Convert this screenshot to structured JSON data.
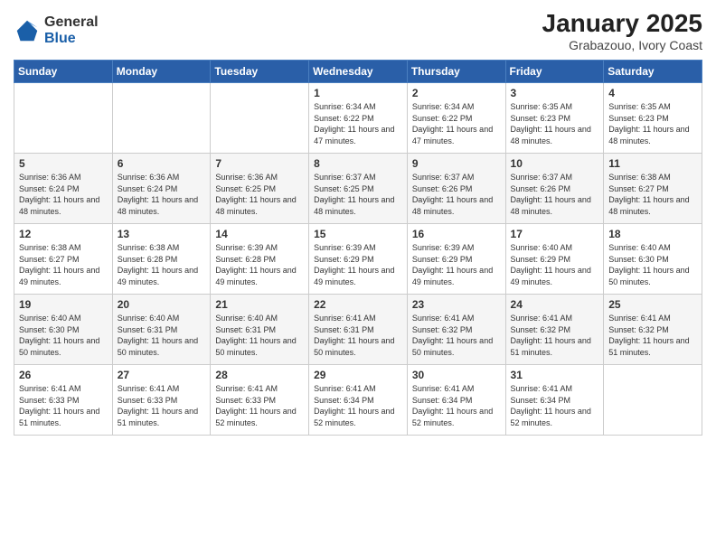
{
  "logo": {
    "general": "General",
    "blue": "Blue"
  },
  "header": {
    "month": "January 2025",
    "location": "Grabazouo, Ivory Coast"
  },
  "weekdays": [
    "Sunday",
    "Monday",
    "Tuesday",
    "Wednesday",
    "Thursday",
    "Friday",
    "Saturday"
  ],
  "weeks": [
    [
      {
        "day": "",
        "sunrise": "",
        "sunset": "",
        "daylight": ""
      },
      {
        "day": "",
        "sunrise": "",
        "sunset": "",
        "daylight": ""
      },
      {
        "day": "",
        "sunrise": "",
        "sunset": "",
        "daylight": ""
      },
      {
        "day": "1",
        "sunrise": "Sunrise: 6:34 AM",
        "sunset": "Sunset: 6:22 PM",
        "daylight": "Daylight: 11 hours and 47 minutes."
      },
      {
        "day": "2",
        "sunrise": "Sunrise: 6:34 AM",
        "sunset": "Sunset: 6:22 PM",
        "daylight": "Daylight: 11 hours and 47 minutes."
      },
      {
        "day": "3",
        "sunrise": "Sunrise: 6:35 AM",
        "sunset": "Sunset: 6:23 PM",
        "daylight": "Daylight: 11 hours and 48 minutes."
      },
      {
        "day": "4",
        "sunrise": "Sunrise: 6:35 AM",
        "sunset": "Sunset: 6:23 PM",
        "daylight": "Daylight: 11 hours and 48 minutes."
      }
    ],
    [
      {
        "day": "5",
        "sunrise": "Sunrise: 6:36 AM",
        "sunset": "Sunset: 6:24 PM",
        "daylight": "Daylight: 11 hours and 48 minutes."
      },
      {
        "day": "6",
        "sunrise": "Sunrise: 6:36 AM",
        "sunset": "Sunset: 6:24 PM",
        "daylight": "Daylight: 11 hours and 48 minutes."
      },
      {
        "day": "7",
        "sunrise": "Sunrise: 6:36 AM",
        "sunset": "Sunset: 6:25 PM",
        "daylight": "Daylight: 11 hours and 48 minutes."
      },
      {
        "day": "8",
        "sunrise": "Sunrise: 6:37 AM",
        "sunset": "Sunset: 6:25 PM",
        "daylight": "Daylight: 11 hours and 48 minutes."
      },
      {
        "day": "9",
        "sunrise": "Sunrise: 6:37 AM",
        "sunset": "Sunset: 6:26 PM",
        "daylight": "Daylight: 11 hours and 48 minutes."
      },
      {
        "day": "10",
        "sunrise": "Sunrise: 6:37 AM",
        "sunset": "Sunset: 6:26 PM",
        "daylight": "Daylight: 11 hours and 48 minutes."
      },
      {
        "day": "11",
        "sunrise": "Sunrise: 6:38 AM",
        "sunset": "Sunset: 6:27 PM",
        "daylight": "Daylight: 11 hours and 48 minutes."
      }
    ],
    [
      {
        "day": "12",
        "sunrise": "Sunrise: 6:38 AM",
        "sunset": "Sunset: 6:27 PM",
        "daylight": "Daylight: 11 hours and 49 minutes."
      },
      {
        "day": "13",
        "sunrise": "Sunrise: 6:38 AM",
        "sunset": "Sunset: 6:28 PM",
        "daylight": "Daylight: 11 hours and 49 minutes."
      },
      {
        "day": "14",
        "sunrise": "Sunrise: 6:39 AM",
        "sunset": "Sunset: 6:28 PM",
        "daylight": "Daylight: 11 hours and 49 minutes."
      },
      {
        "day": "15",
        "sunrise": "Sunrise: 6:39 AM",
        "sunset": "Sunset: 6:29 PM",
        "daylight": "Daylight: 11 hours and 49 minutes."
      },
      {
        "day": "16",
        "sunrise": "Sunrise: 6:39 AM",
        "sunset": "Sunset: 6:29 PM",
        "daylight": "Daylight: 11 hours and 49 minutes."
      },
      {
        "day": "17",
        "sunrise": "Sunrise: 6:40 AM",
        "sunset": "Sunset: 6:29 PM",
        "daylight": "Daylight: 11 hours and 49 minutes."
      },
      {
        "day": "18",
        "sunrise": "Sunrise: 6:40 AM",
        "sunset": "Sunset: 6:30 PM",
        "daylight": "Daylight: 11 hours and 50 minutes."
      }
    ],
    [
      {
        "day": "19",
        "sunrise": "Sunrise: 6:40 AM",
        "sunset": "Sunset: 6:30 PM",
        "daylight": "Daylight: 11 hours and 50 minutes."
      },
      {
        "day": "20",
        "sunrise": "Sunrise: 6:40 AM",
        "sunset": "Sunset: 6:31 PM",
        "daylight": "Daylight: 11 hours and 50 minutes."
      },
      {
        "day": "21",
        "sunrise": "Sunrise: 6:40 AM",
        "sunset": "Sunset: 6:31 PM",
        "daylight": "Daylight: 11 hours and 50 minutes."
      },
      {
        "day": "22",
        "sunrise": "Sunrise: 6:41 AM",
        "sunset": "Sunset: 6:31 PM",
        "daylight": "Daylight: 11 hours and 50 minutes."
      },
      {
        "day": "23",
        "sunrise": "Sunrise: 6:41 AM",
        "sunset": "Sunset: 6:32 PM",
        "daylight": "Daylight: 11 hours and 50 minutes."
      },
      {
        "day": "24",
        "sunrise": "Sunrise: 6:41 AM",
        "sunset": "Sunset: 6:32 PM",
        "daylight": "Daylight: 11 hours and 51 minutes."
      },
      {
        "day": "25",
        "sunrise": "Sunrise: 6:41 AM",
        "sunset": "Sunset: 6:32 PM",
        "daylight": "Daylight: 11 hours and 51 minutes."
      }
    ],
    [
      {
        "day": "26",
        "sunrise": "Sunrise: 6:41 AM",
        "sunset": "Sunset: 6:33 PM",
        "daylight": "Daylight: 11 hours and 51 minutes."
      },
      {
        "day": "27",
        "sunrise": "Sunrise: 6:41 AM",
        "sunset": "Sunset: 6:33 PM",
        "daylight": "Daylight: 11 hours and 51 minutes."
      },
      {
        "day": "28",
        "sunrise": "Sunrise: 6:41 AM",
        "sunset": "Sunset: 6:33 PM",
        "daylight": "Daylight: 11 hours and 52 minutes."
      },
      {
        "day": "29",
        "sunrise": "Sunrise: 6:41 AM",
        "sunset": "Sunset: 6:34 PM",
        "daylight": "Daylight: 11 hours and 52 minutes."
      },
      {
        "day": "30",
        "sunrise": "Sunrise: 6:41 AM",
        "sunset": "Sunset: 6:34 PM",
        "daylight": "Daylight: 11 hours and 52 minutes."
      },
      {
        "day": "31",
        "sunrise": "Sunrise: 6:41 AM",
        "sunset": "Sunset: 6:34 PM",
        "daylight": "Daylight: 11 hours and 52 minutes."
      },
      {
        "day": "",
        "sunrise": "",
        "sunset": "",
        "daylight": ""
      }
    ]
  ]
}
